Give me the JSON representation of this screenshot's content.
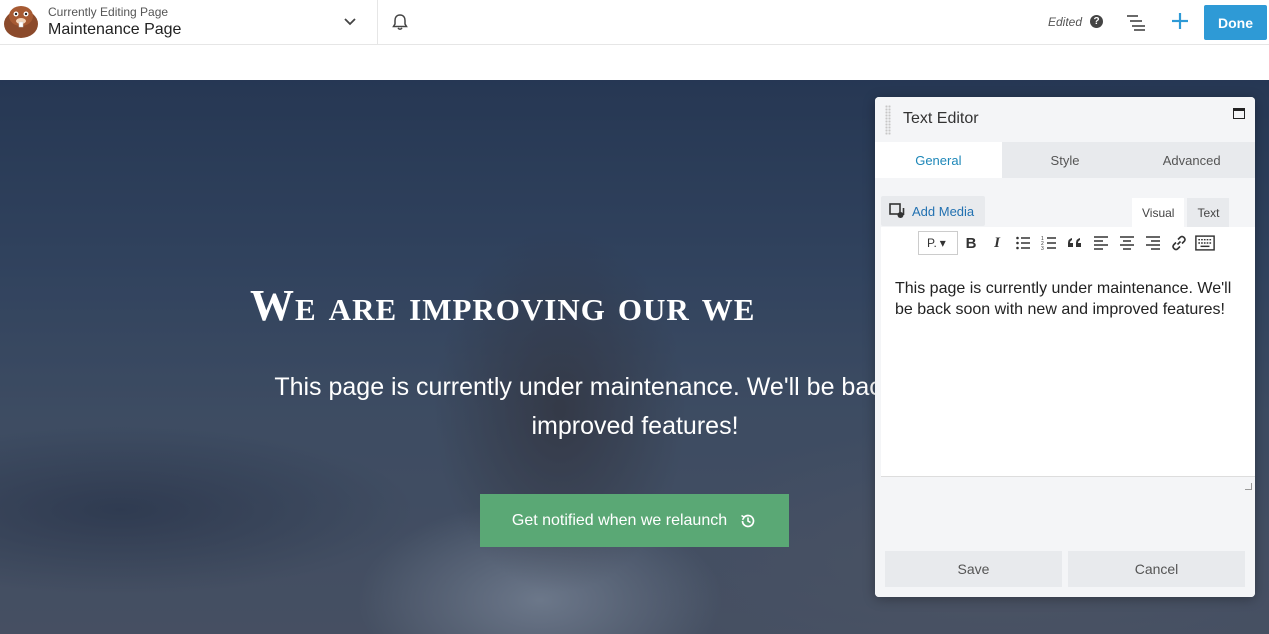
{
  "topbar": {
    "subtitle": "Currently Editing Page",
    "page_name": "Maintenance Page",
    "status": "Edited",
    "help": "?",
    "done_label": "Done"
  },
  "hero": {
    "title": "We are improving our we",
    "text": "This page is currently under maintenance. We'll be back new and improved features!",
    "button_label": "Get notified when we relaunch"
  },
  "panel": {
    "title": "Text Editor",
    "tabs": [
      "General",
      "Style",
      "Advanced"
    ],
    "add_media": "Add Media",
    "mode_tabs": [
      "Visual",
      "Text"
    ],
    "format_value": "P.",
    "content": "This page is currently under maintenance. We'll be back soon with new and improved features!",
    "save_label": "Save",
    "cancel_label": "Cancel"
  },
  "colors": {
    "accent": "#2e9ad6",
    "button_green": "#5aa875",
    "active_tab": "#1e87b8"
  }
}
